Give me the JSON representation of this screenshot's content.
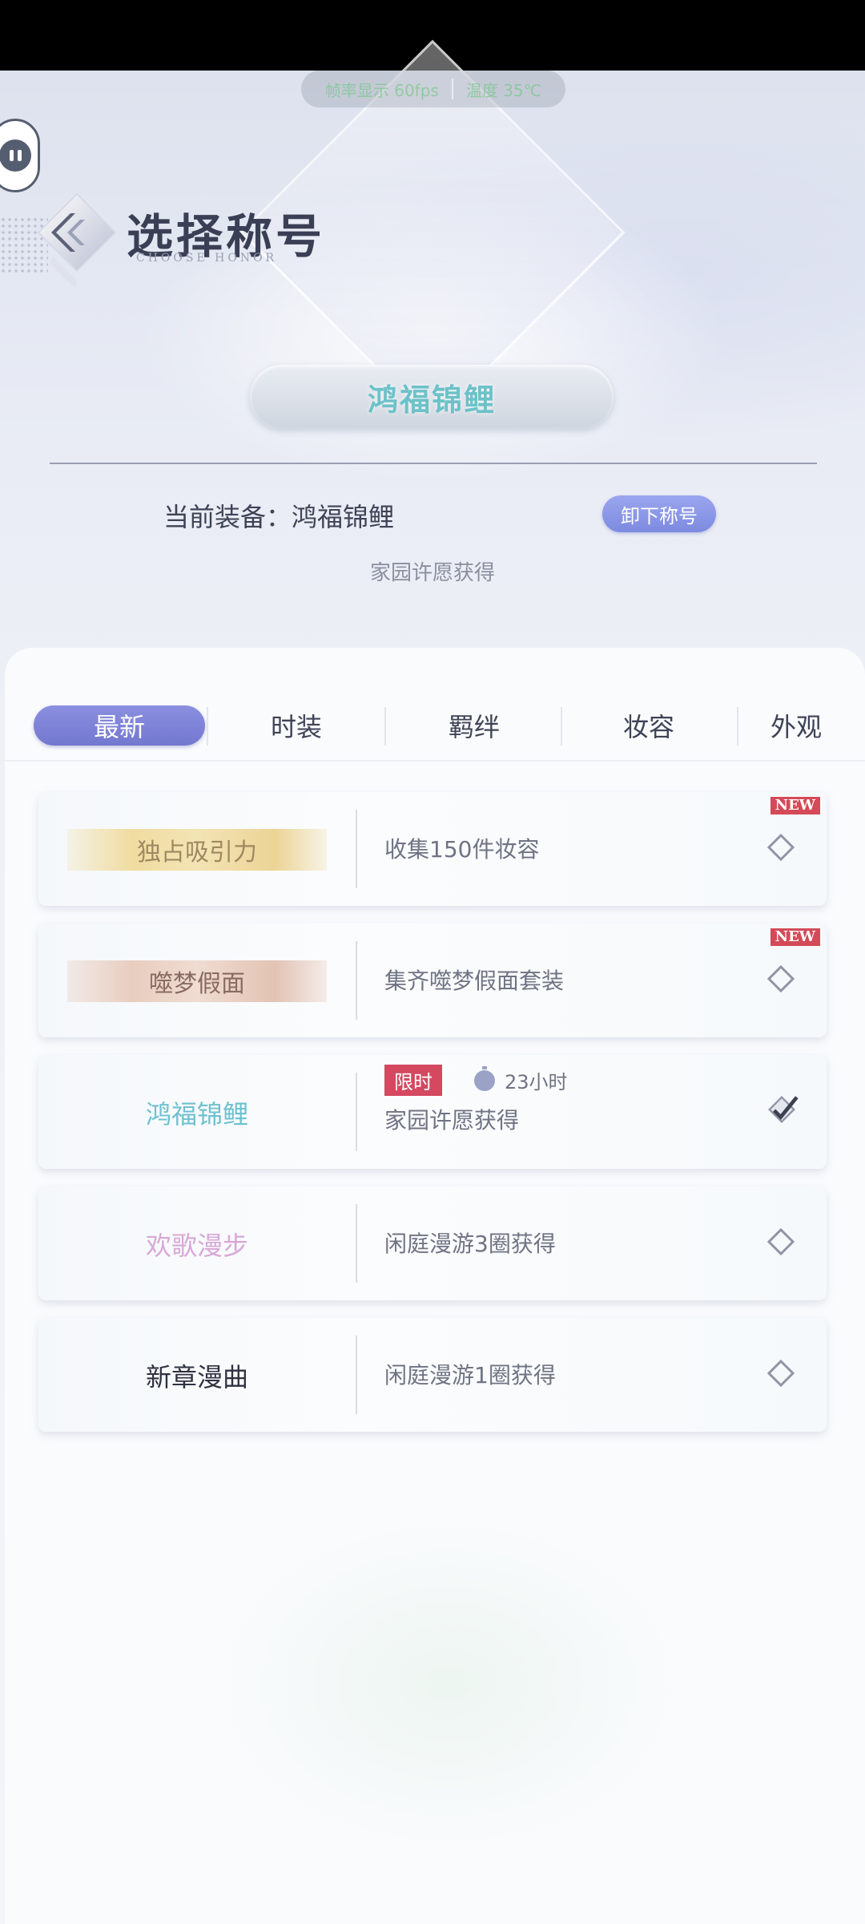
{
  "header": {
    "title": "选择称号",
    "subtitle": "CHOOSE HONOR",
    "perf_overlay": [
      "帧率显示 60fps",
      "温度 35℃"
    ]
  },
  "current": {
    "honor_name": "鸿福锦鲤",
    "equip_label": "当前装备：鸿福锦鲤",
    "unequip_label": "卸下称号",
    "source": "家园许愿获得"
  },
  "tabs": [
    "最新",
    "时装",
    "羁绊",
    "妆容",
    "外观"
  ],
  "active_tab": "最新",
  "honors": [
    {
      "title": "独占吸引力",
      "desc": "收集150件妆容",
      "is_new": true,
      "new_label": "NEW",
      "style": "gold",
      "status": "diamond"
    },
    {
      "title": "噬梦假面",
      "desc": "集齐噬梦假面套装",
      "is_new": true,
      "new_label": "NEW",
      "style": "rose",
      "status": "diamond"
    },
    {
      "title": "鸿福锦鲤",
      "desc": "家园许愿获得",
      "limited_label": "限时",
      "time_left": "23小时",
      "style": "teal",
      "status": "equipped",
      "title_color": "#6ec1d0"
    },
    {
      "title": "欢歌漫步",
      "desc": "闲庭漫游3圈获得",
      "style": "pink",
      "status": "diamond",
      "title_color": "#d8a8d8"
    },
    {
      "title": "新章漫曲",
      "desc": "闲庭漫游1圈获得",
      "style": "dark",
      "status": "diamond",
      "title_color": "#2f3240"
    }
  ],
  "colors": {
    "accent": "#7d8ae0",
    "tab_active": "#7378cf",
    "new_tag": "#d44a58",
    "limited_tag": "#d44860"
  },
  "icons": [
    "back-chevron-icon",
    "float-assistant-icon",
    "diamond-icon",
    "diamond-check-icon",
    "timer-icon"
  ]
}
